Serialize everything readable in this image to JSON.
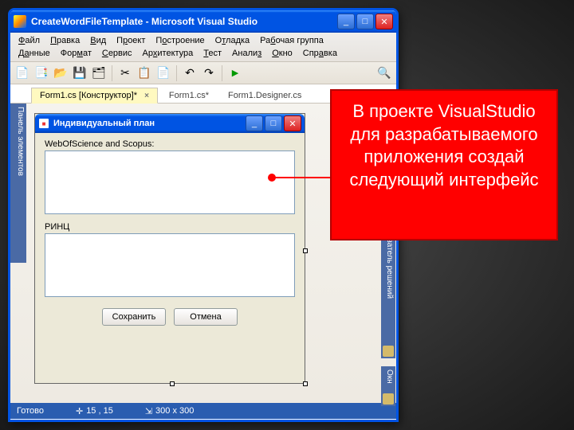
{
  "window": {
    "title": "CreateWordFileTemplate - Microsoft Visual Studio"
  },
  "menu": {
    "row1": [
      "Файл",
      "Правка",
      "Вид",
      "Проект",
      "Построение",
      "Отладка",
      "Рабочая группа"
    ],
    "row2": [
      "Данные",
      "Формат",
      "Сервис",
      "Архитектура",
      "Тест",
      "Анализ",
      "Окно",
      "Справка"
    ]
  },
  "tabs": {
    "t1": "Form1.cs [Конструктор]*",
    "t2": "Form1.cs*",
    "t3": "Form1.Designer.cs"
  },
  "sidepanels": {
    "toolbox": "Панель элементов",
    "solution": "еватель решений",
    "properties": "Окн"
  },
  "form": {
    "title": "Индивидуальный план",
    "label1": "WebOfScience and Scopus:",
    "label2": "РИНЦ",
    "btn_save": "Сохранить",
    "btn_cancel": "Отмена"
  },
  "status": {
    "ready": "Готово",
    "pos": "15 , 15",
    "size": "300 x 300"
  },
  "callout": {
    "text": "В проекте VisualStudio для разрабатываемого приложения создай следующий интерфейс"
  }
}
